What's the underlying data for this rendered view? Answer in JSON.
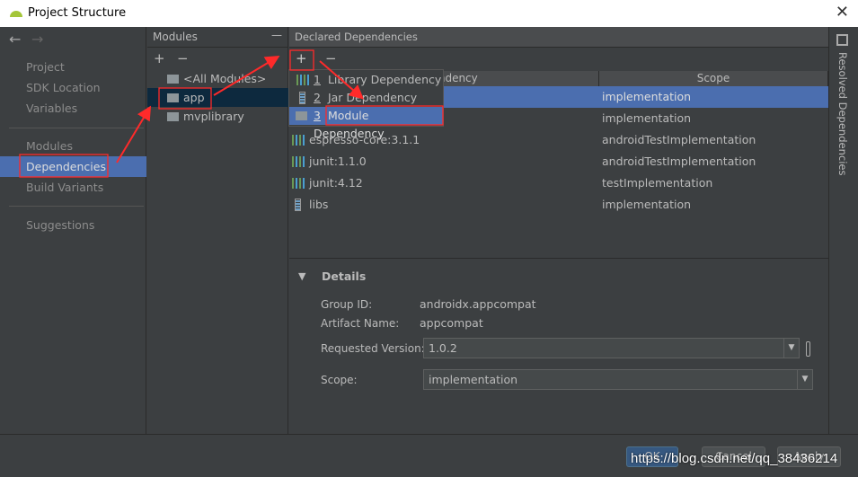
{
  "window": {
    "title": "Project Structure",
    "close_icon": "close-icon"
  },
  "left_nav": {
    "back": "←",
    "forward": "→",
    "items": [
      {
        "label": "Project"
      },
      {
        "label": "SDK Location"
      },
      {
        "label": "Variables"
      },
      {
        "label": "Modules"
      },
      {
        "label": "Dependencies",
        "selected": true
      },
      {
        "label": "Build Variants"
      },
      {
        "label": "Suggestions"
      }
    ]
  },
  "modules": {
    "title": "Modules",
    "add": "+",
    "remove": "−",
    "collapse": "—",
    "items": [
      {
        "label": "<All Modules>"
      },
      {
        "label": "app",
        "selected": true
      },
      {
        "label": "mvplibrary"
      }
    ]
  },
  "declared": {
    "title": "Declared Dependencies",
    "add": "+",
    "remove": "−",
    "columns": [
      "Dependency",
      "Scope"
    ],
    "rows": [
      {
        "name": "",
        "scope": "implementation",
        "icon": "library",
        "selected": true
      },
      {
        "name": "",
        "scope": "implementation",
        "icon": "library"
      },
      {
        "name": "espresso-core:3.1.1",
        "scope": "androidTestImplementation",
        "icon": "library"
      },
      {
        "name": "junit:1.1.0",
        "scope": "androidTestImplementation",
        "icon": "library"
      },
      {
        "name": "junit:4.12",
        "scope": "testImplementation",
        "icon": "library"
      },
      {
        "name": "libs",
        "scope": "implementation",
        "icon": "jar"
      }
    ]
  },
  "add_menu": [
    {
      "num": "1",
      "label": "Library Dependency"
    },
    {
      "num": "2",
      "label": "Jar Dependency"
    },
    {
      "num": "3",
      "label": "Module Dependency",
      "selected": true
    }
  ],
  "details": {
    "title": "Details",
    "group_id_label": "Group ID:",
    "group_id": "androidx.appcompat",
    "artifact_label": "Artifact Name:",
    "artifact": "appcompat",
    "version_label": "Requested Version:",
    "version": "1.0.2",
    "scope_label": "Scope:",
    "scope": "implementation"
  },
  "side_tab": "Resolved Dependencies",
  "buttons": {
    "ok": "OK",
    "cancel": "Cancel",
    "apply": "Apply"
  },
  "watermark": "https://blog.csdn.net/qq_38436214",
  "colors": {
    "selection": "#4b6eaf",
    "background": "#3c3f41",
    "annotation": "#ff2a2a"
  }
}
